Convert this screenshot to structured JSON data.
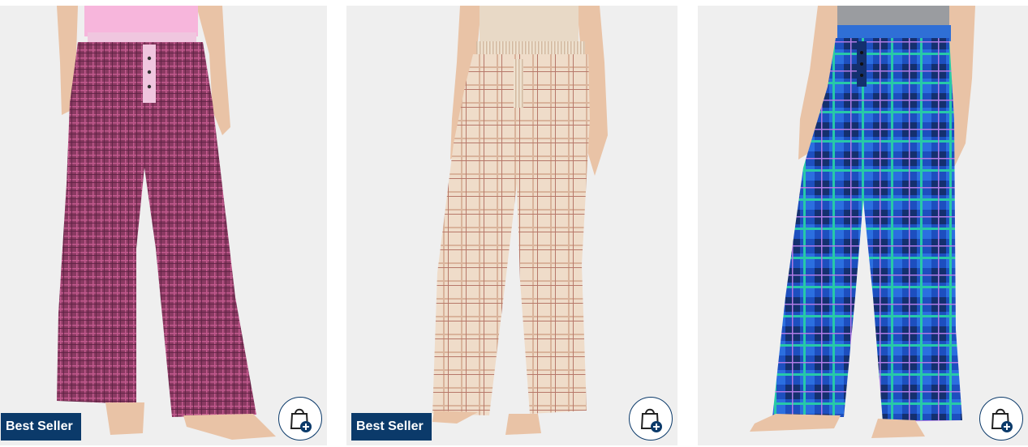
{
  "products": [
    {
      "badge": "Best Seller",
      "show_badge": true,
      "colors": {
        "pant": "#8a3a62",
        "top": "#f7b6dc",
        "band": "#f0c6df",
        "skin": "#e9c3a6",
        "line": "#c25a8e"
      },
      "add_to_bag_icon": "shopping-bag-plus-icon"
    },
    {
      "badge": "Best Seller",
      "show_badge": true,
      "colors": {
        "pant": "#efdcc9",
        "top": "#e8d9c6",
        "band": "#e6d8c4",
        "skin": "#e9c3a6",
        "line": "#c79b82"
      },
      "add_to_bag_icon": "shopping-bag-plus-icon"
    },
    {
      "badge": "",
      "show_badge": false,
      "colors": {
        "pant": "#1d4fbf",
        "top": "#9a9ca0",
        "band": "#2f6fd6",
        "skin": "#e9c3a6",
        "line": "#27c9a8"
      },
      "add_to_bag_icon": "shopping-bag-plus-icon"
    }
  ],
  "accent_color": "#0b3a6a"
}
